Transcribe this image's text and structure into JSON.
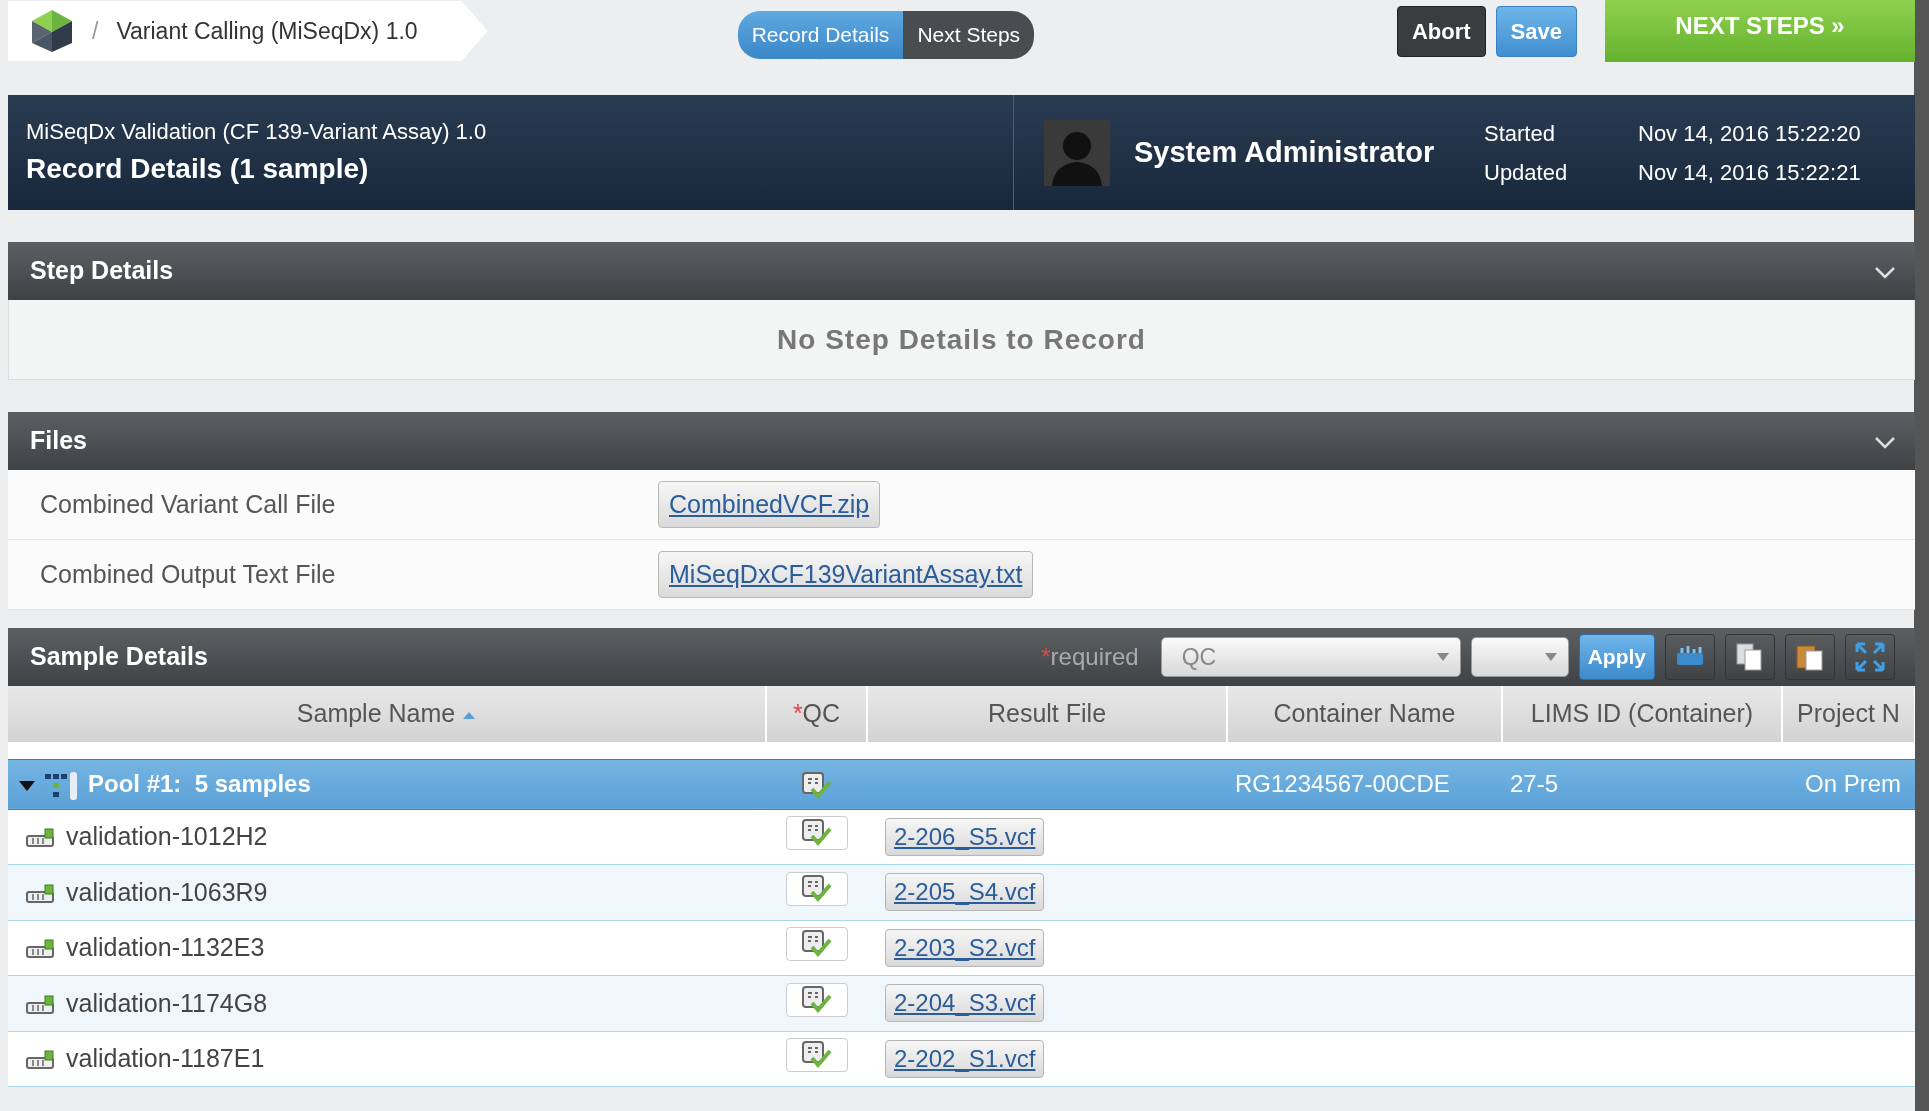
{
  "breadcrumb": {
    "separator": "/",
    "title": "Variant Calling (MiSeqDx) 1.0"
  },
  "tabs": [
    {
      "label": "Record Details",
      "selected": true
    },
    {
      "label": "Next Steps",
      "selected": false
    }
  ],
  "buttons": {
    "abort": "Abort",
    "save": "Save",
    "next_steps": "NEXT STEPS »"
  },
  "header": {
    "protocol": "MiSeqDx Validation (CF 139-Variant Assay) 1.0",
    "title": "Record Details (1 sample)",
    "user": "System Administrator",
    "started_label": "Started",
    "started": "Nov 14, 2016 15:22:20",
    "updated_label": "Updated",
    "updated": "Nov 14, 2016 15:22:21"
  },
  "step_details": {
    "title": "Step Details",
    "message": "No Step Details to Record"
  },
  "files": {
    "title": "Files",
    "rows": [
      {
        "label": "Combined Variant Call File",
        "file": "CombinedVCF.zip"
      },
      {
        "label": "Combined Output Text File",
        "file": "MiSeqDxCF139VariantAssay.txt"
      }
    ]
  },
  "sample_details": {
    "title": "Sample Details",
    "required_mark": "*",
    "required_label": "required",
    "field_select": "QC",
    "apply": "Apply",
    "columns": [
      {
        "label": "Sample Name",
        "required": false,
        "sorted": true
      },
      {
        "label": "QC",
        "required": true,
        "sorted": false
      },
      {
        "label": "Result File",
        "required": false,
        "sorted": false
      },
      {
        "label": "Container Name",
        "required": false,
        "sorted": false
      },
      {
        "label": "LIMS ID (Container)",
        "required": false,
        "sorted": false
      },
      {
        "label": "Project N",
        "required": false,
        "sorted": false
      }
    ],
    "pool": {
      "expanded": true,
      "label": "Pool #1:  5 samples",
      "container_name": "RG1234567-00CDE",
      "lims_id": "27-5",
      "project": "On Prem"
    },
    "samples": [
      {
        "name": "validation-1012H2",
        "qc_passed": true,
        "result_file": "2-206_S5.vcf"
      },
      {
        "name": "validation-1063R9",
        "qc_passed": true,
        "result_file": "2-205_S4.vcf"
      },
      {
        "name": "validation-1132E3",
        "qc_passed": true,
        "result_file": "2-203_S2.vcf"
      },
      {
        "name": "validation-1174G8",
        "qc_passed": true,
        "result_file": "2-204_S3.vcf"
      },
      {
        "name": "validation-1187E1",
        "qc_passed": true,
        "result_file": "2-202_S1.vcf"
      }
    ]
  }
}
